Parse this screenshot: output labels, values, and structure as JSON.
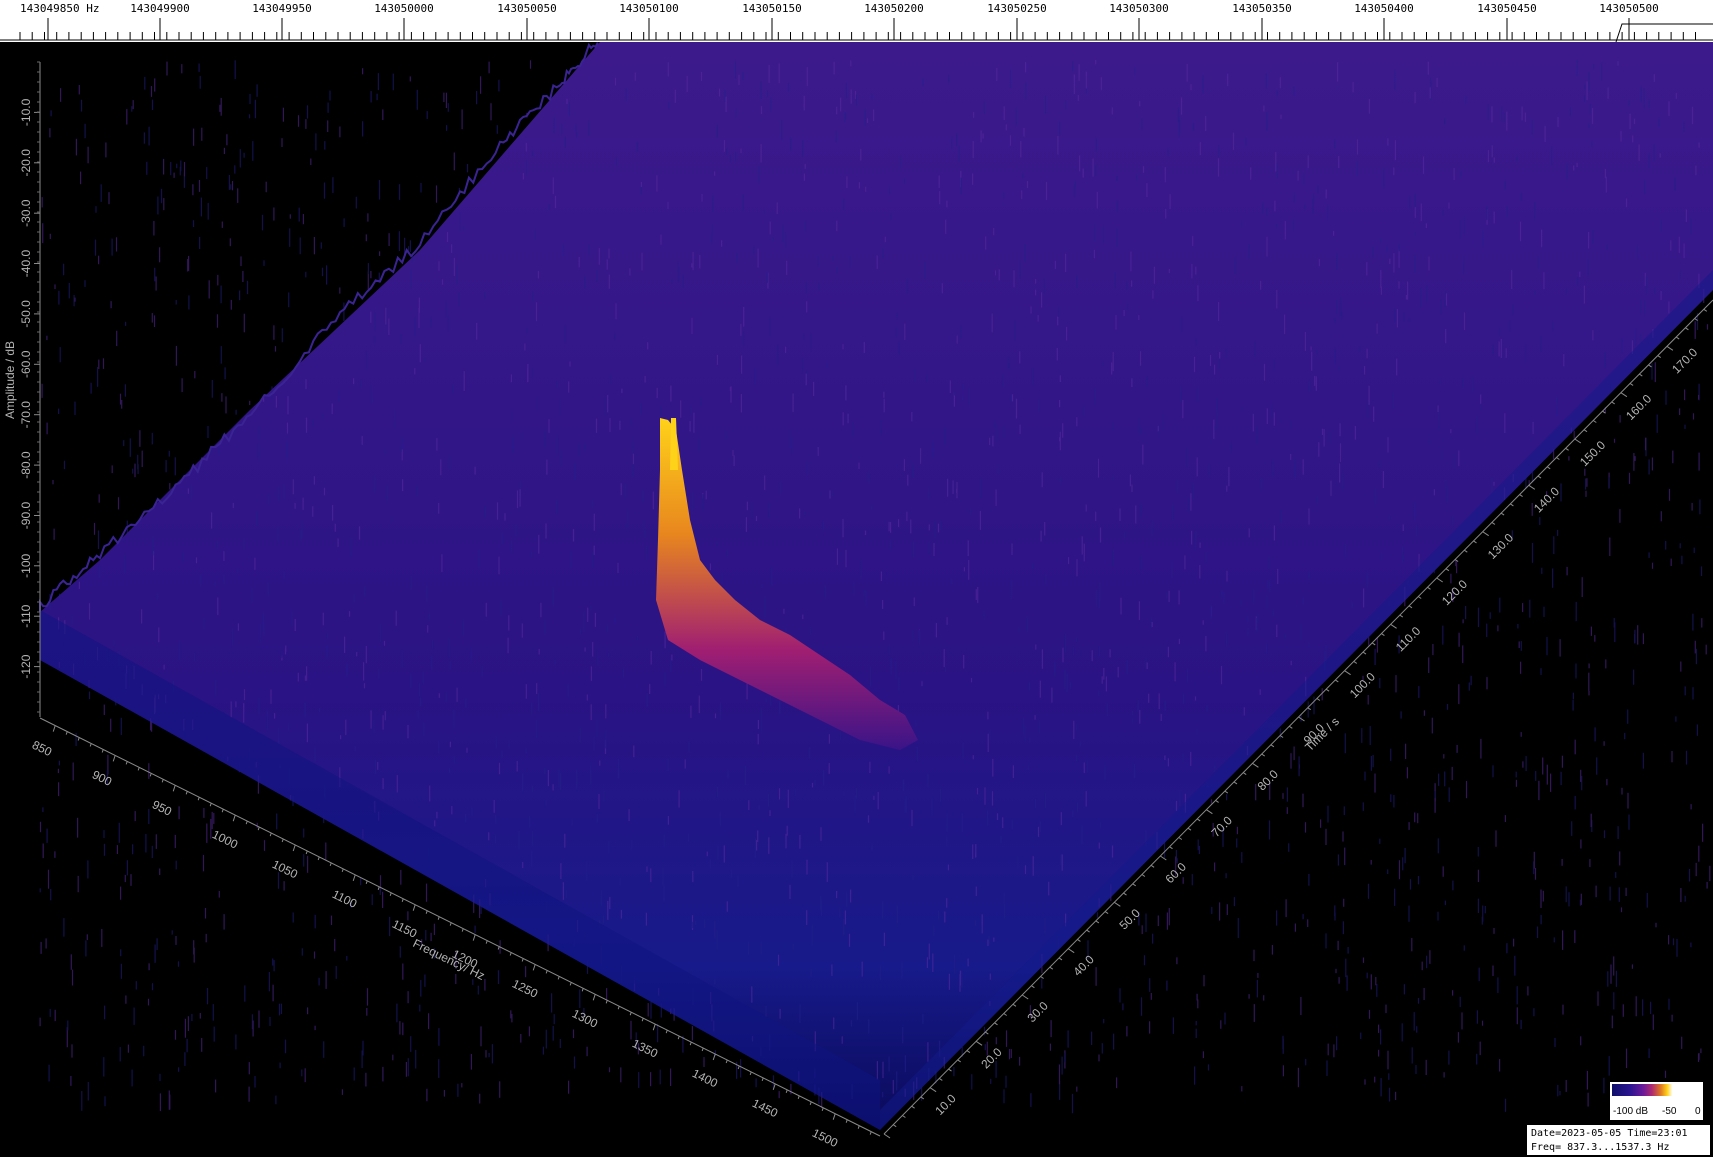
{
  "chart_data": {
    "type": "area",
    "top_axis": {
      "unit_label": "143049850 Hz",
      "ticks": [
        "143049900",
        "143049950",
        "143050000",
        "143050050",
        "143050100",
        "143050150",
        "143050200",
        "143050250",
        "143050300",
        "143050350",
        "143050400",
        "143050450",
        "143050500"
      ]
    },
    "amplitude_axis": {
      "label": "Amplitude / dB",
      "ticks": [
        "-10.0",
        "-20.0",
        "-30.0",
        "-40.0",
        "-50.0",
        "-60.0",
        "-70.0",
        "-80.0",
        "-90.0",
        "-100",
        "-110",
        "-120"
      ],
      "range": [
        -130,
        0
      ]
    },
    "frequency_axis": {
      "label": "Frequency/ Hz",
      "ticks": [
        "850",
        "900",
        "950",
        "1000",
        "1050",
        "1100",
        "1150",
        "1200",
        "1250",
        "1300",
        "1350",
        "1400",
        "1450",
        "1500"
      ],
      "range": [
        837.3,
        1537.3
      ]
    },
    "time_axis": {
      "label": "Time / s",
      "ticks": [
        "10.0",
        "20.0",
        "30.0",
        "40.0",
        "50.0",
        "60.0",
        "70.0",
        "80.0",
        "90.0",
        "100.0",
        "110.0",
        "120.0",
        "130.0",
        "140.0",
        "150.0",
        "160.0",
        "170.0"
      ],
      "range": [
        0,
        180
      ]
    },
    "colormap": [
      "#10106a",
      "#2a1490",
      "#6a1a9a",
      "#b02a70",
      "#e07a20",
      "#ffd21a",
      "#ffffff"
    ],
    "noise_floor_db": -118,
    "signal": {
      "frequency_hz": 1175,
      "peak_db": -70,
      "peak_time_s": 178,
      "decay_to_time_s": 55,
      "decay_floor_db": -108
    }
  },
  "legend": {
    "min_label": "-100 dB",
    "mid_label": "-50",
    "max_label": "0"
  },
  "info": {
    "line1": "Date=2023-05-05 Time=23:01",
    "line2": "Freq= 837.3...1537.3 Hz"
  }
}
